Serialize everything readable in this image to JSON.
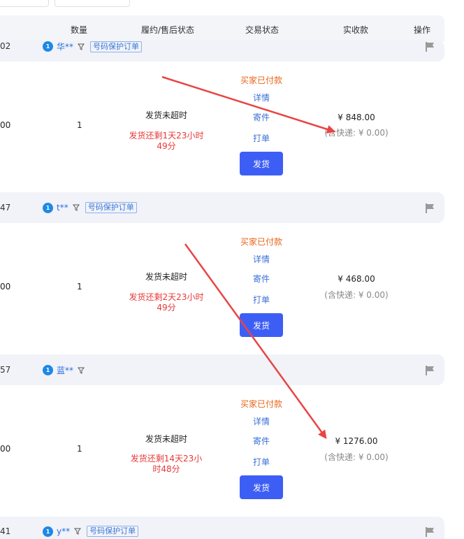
{
  "table_headers": {
    "quantity": "数量",
    "fulfillment": "履约/售后状态",
    "trade_status": "交易状态",
    "received": "实收款",
    "actions": "操作"
  },
  "orders": [
    {
      "order_no_tail": "02",
      "buyer": "华**",
      "tag": "号码保护订单",
      "row_value": "00",
      "quantity": "1",
      "timeout_status": "发货未超时",
      "remaining_line1": "发货还剩1天23小时",
      "remaining_line2": "49分",
      "trade_status": "买家已付款",
      "detail": "详情",
      "send_item": "寄件",
      "print": "打单",
      "ship": "发货",
      "price": "¥ 848.00",
      "shipping_note": "(含快递: ¥ 0.00)"
    },
    {
      "order_no_tail": "47",
      "buyer": "t**",
      "tag": "号码保护订单",
      "row_value": "00",
      "quantity": "1",
      "timeout_status": "发货未超时",
      "remaining_line1": "发货还剩2天23小时",
      "remaining_line2": "49分",
      "trade_status": "买家已付款",
      "detail": "详情",
      "send_item": "寄件",
      "print": "打单",
      "ship": "发货",
      "price": "¥ 468.00",
      "shipping_note": "(含快递: ¥ 0.00)"
    },
    {
      "order_no_tail": "57",
      "buyer": "蓝**",
      "tag": "",
      "row_value": "00",
      "quantity": "1",
      "timeout_status": "发货未超时",
      "remaining_line1": "发货还剩14天23小",
      "remaining_line2": "时48分",
      "trade_status": "买家已付款",
      "detail": "详情",
      "send_item": "寄件",
      "print": "打单",
      "ship": "发货",
      "price": "¥ 1276.00",
      "shipping_note": "(含快递: ¥ 0.00)"
    },
    {
      "order_no_tail": "41",
      "buyer": "y**",
      "tag": "号码保护订单"
    }
  ],
  "colors": {
    "accent": "#3d5ef5",
    "status_orange": "#e8651a",
    "countdown_red": "#e83838",
    "link_blue": "#3a6fd8",
    "arrow_red": "#e84545"
  }
}
